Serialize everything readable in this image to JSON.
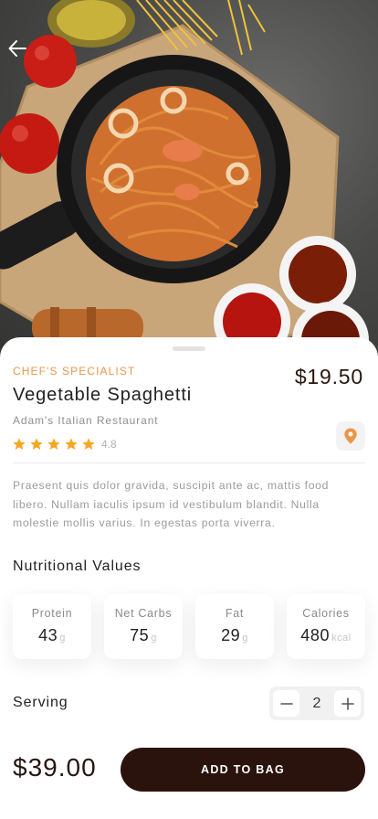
{
  "hero": {
    "back_icon": "arrow-left-icon",
    "photo": "spaghetti in cast iron pan"
  },
  "dish": {
    "tag": "CHEF'S SPECIALIST",
    "price": "$19.50",
    "title": "Vegetable Spaghetti",
    "restaurant": "Adam's Italian Restaurant",
    "rating": "4.8",
    "stars": 5,
    "location_icon": "map-pin-icon",
    "description": "Praesent quis dolor gravida, suscipit ante ac, mattis food libero. Nullam iaculis ipsum id vestibulum blandit. Nulla molestie mollis varius. In egestas porta viverra."
  },
  "nutrition": {
    "title": "Nutritional Values",
    "items": [
      {
        "label": "Protein",
        "value": "43",
        "unit": "g"
      },
      {
        "label": "Net Carbs",
        "value": "75",
        "unit": "g"
      },
      {
        "label": "Fat",
        "value": "29",
        "unit": "g"
      },
      {
        "label": "Calories",
        "value": "480",
        "unit": "kcal"
      }
    ]
  },
  "serving": {
    "label": "Serving",
    "value": "2",
    "minus_icon": "minus-icon",
    "plus_icon": "plus-icon"
  },
  "footer": {
    "total": "$39.00",
    "button_label": "ADD TO BAG"
  },
  "colors": {
    "accent": "#e8974a",
    "star": "#f5a623",
    "brand_dark": "#2b130d",
    "pin": "#e8974a"
  }
}
